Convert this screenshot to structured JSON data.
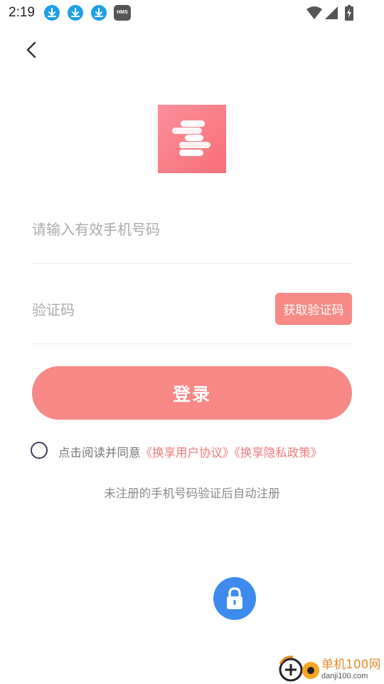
{
  "status_bar": {
    "time": "2:19",
    "icons": [
      "download-icon",
      "download-icon",
      "download-icon",
      "hms-icon",
      "wifi-icon",
      "signal-icon",
      "battery-icon"
    ],
    "hms_label": "HMS"
  },
  "nav": {
    "back_icon": "chevron-left-icon"
  },
  "login": {
    "phone_placeholder": "请输入有效手机号码",
    "code_placeholder": "验证码",
    "get_code_label": "获取验证码",
    "login_label": "登录",
    "agree_prefix": "点击阅读并同意",
    "user_agreement": "《换享用户协议》",
    "privacy_policy": "《换享隐私政策》",
    "register_note": "未注册的手机号码验证后自动注册"
  },
  "watermark": {
    "title": "单机100网",
    "subtitle": "danji100.com"
  },
  "colors": {
    "accent": "#f78886",
    "link": "#ef7a78",
    "lock_button": "#3c8bed",
    "download_badge": "#1ea0e6"
  }
}
